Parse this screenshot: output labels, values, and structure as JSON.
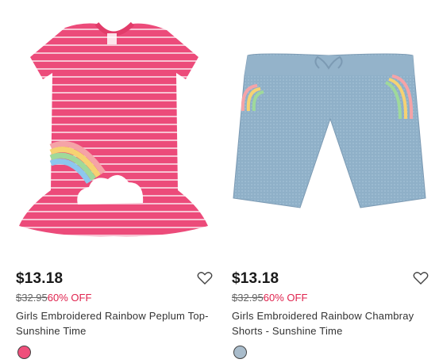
{
  "products": [
    {
      "price": "$13.18",
      "original_price": "$32.95",
      "discount": "60% OFF",
      "title": "Girls Embroidered Rainbow Peplum Top- Sunshine Time",
      "swatch_color": "#ef4f7b",
      "image_icon": "pink-striped-rainbow-top-image",
      "favorite_icon": "heart-outline-icon"
    },
    {
      "price": "$13.18",
      "original_price": "$32.95",
      "discount": "60% OFF",
      "title": "Girls Embroidered Rainbow Chambray Shorts - Sunshine Time",
      "swatch_color": "#a9bccb",
      "image_icon": "chambray-rainbow-shorts-image",
      "favorite_icon": "heart-outline-icon"
    }
  ],
  "colors": {
    "price_text": "#1a1a1a",
    "discount_text": "#e0234e",
    "strike_text": "#666666"
  }
}
